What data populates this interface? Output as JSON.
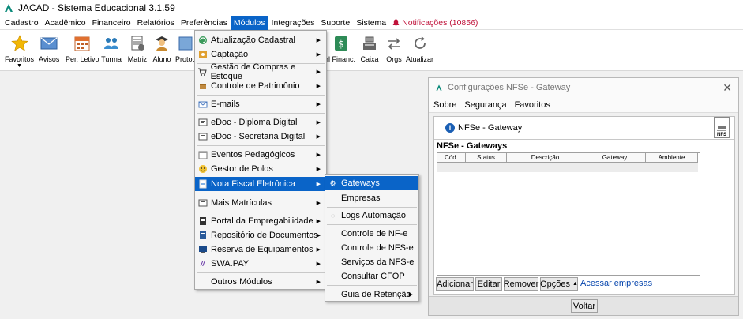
{
  "window": {
    "title": "JACAD - Sistema Educacional 3.1.59"
  },
  "menubar": {
    "items": [
      "Cadastro",
      "Acadêmico",
      "Financeiro",
      "Relatórios",
      "Preferências",
      "Módulos",
      "Integrações",
      "Suporte",
      "Sistema"
    ],
    "notifications": "Notificações (10856)"
  },
  "toolbar": {
    "items": [
      "Favoritos",
      "Avisos",
      "Per. Letivo",
      "Turma",
      "Matriz",
      "Aluno",
      "Protoc",
      "rl Financ.",
      "Caixa",
      "Orgs",
      "Atualizar"
    ]
  },
  "modulos_menu": {
    "items": [
      {
        "label": "Atualização Cadastral",
        "icon": "refresh-user-icon",
        "submenu": true
      },
      {
        "label": "Captação",
        "icon": "capture-icon",
        "submenu": true
      },
      {
        "label": "Gestão de Compras e Estoque",
        "icon": "cart-icon",
        "submenu": true
      },
      {
        "label": "Controle de Patrimônio",
        "icon": "box-icon",
        "submenu": true
      },
      {
        "label": "E-mails",
        "icon": "email-icon",
        "submenu": true
      },
      {
        "label": "eDoc - Diploma Digital",
        "icon": "edoc-icon",
        "submenu": true
      },
      {
        "label": "eDoc - Secretaria Digital",
        "icon": "edoc-icon",
        "submenu": true
      },
      {
        "label": "Eventos Pedagógicos",
        "icon": "calendar-icon",
        "submenu": true
      },
      {
        "label": "Gestor de Polos",
        "icon": "emoji-icon",
        "submenu": true
      },
      {
        "label": "Nota Fiscal Eletrônica",
        "icon": "invoice-icon",
        "submenu": true
      },
      {
        "label": "Mais Matrículas",
        "icon": "enroll-icon",
        "submenu": true
      },
      {
        "label": "Portal da Empregabilidade",
        "icon": "portal-icon",
        "submenu": true
      },
      {
        "label": "Repositório de Documentos",
        "icon": "docs-icon",
        "submenu": true
      },
      {
        "label": "Reserva de Equipamentos",
        "icon": "monitor-icon",
        "submenu": true
      },
      {
        "label": "SWA.PAY",
        "icon": "swapay-icon",
        "submenu": true
      },
      {
        "label": "Outros Módulos",
        "icon": "",
        "submenu": true
      }
    ]
  },
  "nfe_submenu": {
    "items": [
      "Gateways",
      "Empresas",
      "Logs Automação",
      "Controle de NF-e",
      "Controle de NFS-e",
      "Serviços da NFS-e",
      "Consultar CFOP",
      "Guia de Retenção"
    ]
  },
  "dialog": {
    "title": "Configurações NFSe - Gateway",
    "menu": [
      "Sobre",
      "Segurança",
      "Favoritos"
    ],
    "header": "NFSe - Gateway",
    "group_title": "NFSe - Gateways",
    "columns": [
      "Cód.",
      "Status",
      "Descrição",
      "Gateway",
      "Ambiente"
    ],
    "buttons": {
      "add": "Adicionar",
      "edit": "Editar",
      "remove": "Remover",
      "options": "Opções"
    },
    "link": "Acessar empresas",
    "back": "Voltar",
    "corner_icon_label": "NFS"
  },
  "colors": {
    "highlight": "#0a64c8",
    "notification": "#c0123a",
    "link": "#0645ad"
  }
}
